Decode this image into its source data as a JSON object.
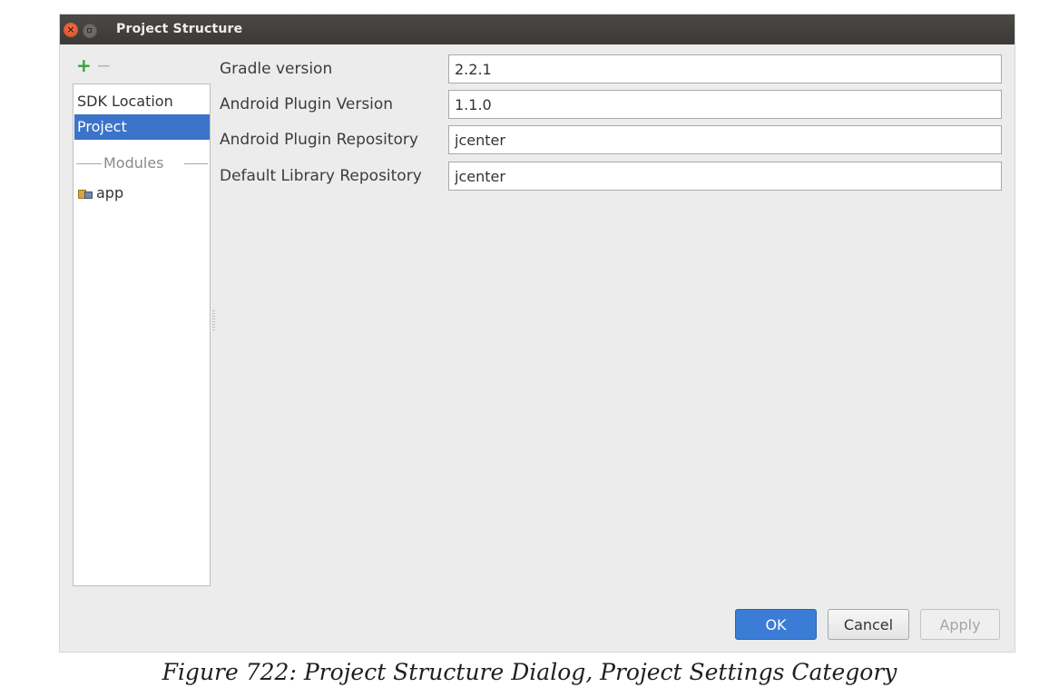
{
  "dialog": {
    "title": "Project Structure",
    "close_glyph": "×",
    "toolbar": {
      "add": "+",
      "remove": "−"
    },
    "sidebar": {
      "items": [
        {
          "label": "SDK Location",
          "selected": false
        },
        {
          "label": "Project",
          "selected": true
        }
      ],
      "modules_header": "Modules",
      "modules": [
        {
          "label": "app",
          "icon": "module-folder-icon"
        }
      ]
    },
    "form": {
      "rows": [
        {
          "label": "Gradle version",
          "value": "2.2.1"
        },
        {
          "label": "Android Plugin Version",
          "value": "1.1.0"
        },
        {
          "label": "Android Plugin Repository",
          "value": "jcenter"
        },
        {
          "label": "Default Library Repository",
          "value": "jcenter"
        }
      ]
    },
    "buttons": {
      "ok": "OK",
      "cancel": "Cancel",
      "apply": "Apply"
    }
  },
  "caption": "Figure 722: Project Structure Dialog, Project Settings Category",
  "colors": {
    "accent": "#3b73c9",
    "titlebar": "#3f3e3a",
    "dialog_bg": "#ececec"
  }
}
